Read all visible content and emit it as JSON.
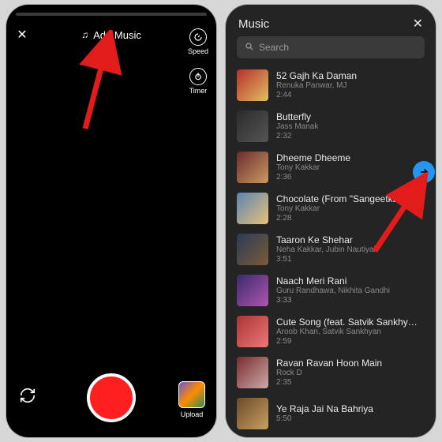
{
  "left": {
    "add_music_label": "Add Music",
    "tools": {
      "speed_label": "Speed",
      "timer_label": "Timer"
    },
    "upload_label": "Upload"
  },
  "right": {
    "header_title": "Music",
    "search_placeholder": "Search",
    "tracks": [
      {
        "title": "52 Gajh Ka Daman",
        "artist": "Renuka Panwar, MJ",
        "duration": "2:44"
      },
      {
        "title": "Butterfly",
        "artist": "Jass Manak",
        "duration": "2:32"
      },
      {
        "title": "Dheeme Dheeme",
        "artist": "Tony Kakkar",
        "duration": "2:36"
      },
      {
        "title": "Chocolate (From \"Sangeetkaar\")",
        "artist": "Tony Kakkar",
        "duration": "2:28"
      },
      {
        "title": "Taaron Ke Shehar",
        "artist": "Neha Kakkar, Jubin Nautiyal",
        "duration": "3:51"
      },
      {
        "title": "Naach Meri Rani",
        "artist": "Guru Randhawa, Nikhita Gandhi",
        "duration": "3:33"
      },
      {
        "title": "Cute Song (feat. Satvik Sankhy…",
        "artist": "Aroob Khan, Satvik Sankhyan",
        "duration": "2:59"
      },
      {
        "title": "Ravan Ravan Hoon Main",
        "artist": "Rock D",
        "duration": "2:35"
      },
      {
        "title": "Ye Raja Jai Na Bahriya",
        "artist": "",
        "duration": "5:50"
      }
    ]
  }
}
